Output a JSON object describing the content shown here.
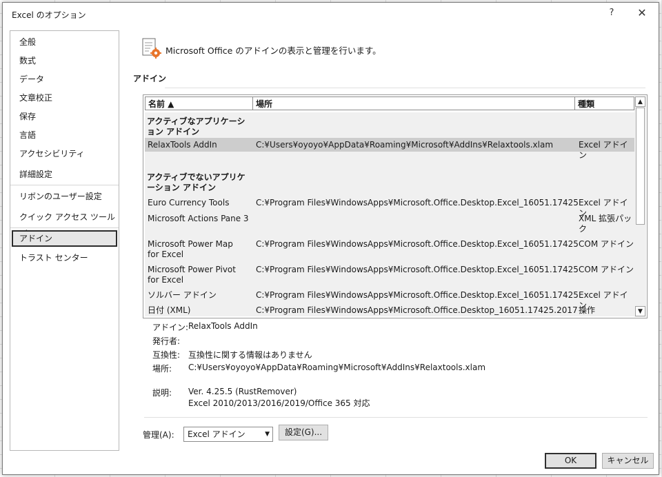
{
  "window": {
    "title": "Excel のオプション",
    "help": "?",
    "close": "✕"
  },
  "nav": {
    "items": [
      "全般",
      "数式",
      "データ",
      "文章校正",
      "保存",
      "言語",
      "アクセシビリティ",
      "詳細設定",
      "リボンのユーザー設定",
      "クイック アクセス ツール バー",
      "アドイン",
      "トラスト センター"
    ],
    "selected": "アドイン"
  },
  "header": {
    "text": "Microsoft Office のアドインの表示と管理を行います。"
  },
  "section": {
    "title": "アドイン"
  },
  "table": {
    "columns": [
      "名前 ▲",
      "場所",
      "種類"
    ],
    "groups": [
      "アクティブなアプリケーション アドイン",
      "アクティブでないアプリケーション アドイン"
    ],
    "rows": [
      {
        "name": "RelaxTools AddIn",
        "location": "C:¥Users¥oyoyo¥AppData¥Roaming¥Microsoft¥AddIns¥Relaxtools.xlam",
        "type": "Excel アドイン"
      },
      {
        "name": "Euro Currency Tools",
        "location": "C:¥Program Files¥WindowsApps¥Microsoft.Office.Desktop.Excel_16051.17425",
        "type": "Excel アドイン"
      },
      {
        "name": "Microsoft Actions Pane 3",
        "location": "",
        "type": "XML 拡張パック"
      },
      {
        "name": "Microsoft Power Map for Excel",
        "location": "C:¥Program Files¥WindowsApps¥Microsoft.Office.Desktop.Excel_16051.17425",
        "type": "COM アドイン"
      },
      {
        "name": "Microsoft Power Pivot for Excel",
        "location": "C:¥Program Files¥WindowsApps¥Microsoft.Office.Desktop.Excel_16051.17425",
        "type": "COM アドイン"
      },
      {
        "name": "ソルバー アドイン",
        "location": "C:¥Program Files¥WindowsApps¥Microsoft.Office.Desktop.Excel_16051.17425",
        "type": "Excel アドイン"
      },
      {
        "name": "日付 (XML)",
        "location": "C:¥Program Files¥WindowsApps¥Microsoft.Office.Desktop_16051.17425.2017",
        "type": "操作"
      }
    ],
    "scroll_up": "▲",
    "scroll_down": "▼"
  },
  "details": {
    "addin_label": "アドイン:",
    "addin_value": "RelaxTools AddIn",
    "publisher_label": "発行者:",
    "publisher_value": "",
    "compat_label": "互換性:",
    "compat_value": "互換性に関する情報はありません",
    "location_label": "場所:",
    "location_value": "C:¥Users¥oyoyo¥AppData¥Roaming¥Microsoft¥AddIns¥Relaxtools.xlam",
    "desc_label": "説明:",
    "desc_line1": "Ver. 4.25.5 (RustRemover)",
    "desc_line2": "Excel 2010/2013/2016/2019/Office 365 対応"
  },
  "manage": {
    "label": "管理(A):",
    "selected": "Excel アドイン",
    "arrow": "▼",
    "settings_button": "設定(G)..."
  },
  "footer": {
    "ok": "OK",
    "cancel": "キャンセル"
  },
  "colors": {
    "selected_row": "#cdcdcd",
    "list_bg": "#f0f0f0",
    "icon_accent": "#e8742a"
  }
}
